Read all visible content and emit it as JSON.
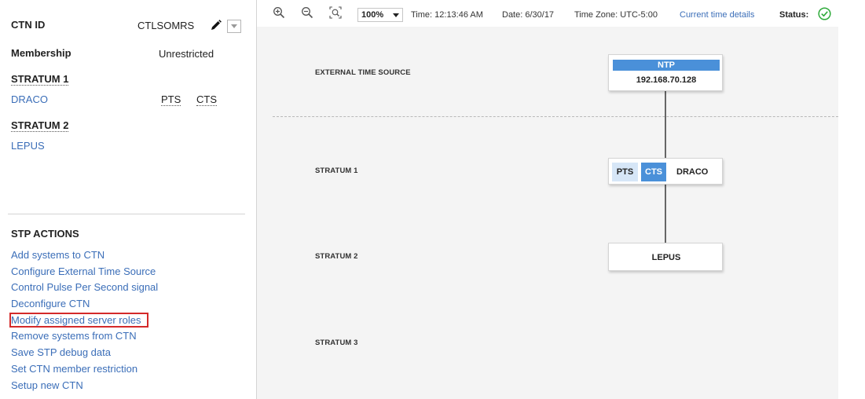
{
  "left_panel": {
    "ctn_id_label": "CTN ID",
    "ctn_id_value": "CTLSOMRS",
    "membership_label": "Membership",
    "membership_value": "Unrestricted",
    "stratum1_heading": "STRATUM 1",
    "stratum1_system": "DRACO",
    "roles": [
      "PTS",
      "CTS"
    ],
    "stratum2_heading": "STRATUM 2",
    "stratum2_system": "LEPUS",
    "actions_title": "STP ACTIONS",
    "actions": [
      "Add systems to CTN",
      "Configure External Time Source",
      "Control Pulse Per Second signal",
      "Deconfigure CTN",
      "Modify assigned server roles",
      "Remove systems from CTN",
      "Save STP debug data",
      "Set CTN member restriction",
      "Setup new CTN"
    ],
    "highlighted_action": "Modify assigned server roles"
  },
  "toolbar": {
    "zoom_in_icon": "zoom-in-icon",
    "zoom_out_icon": "zoom-out-icon",
    "fit_icon": "fit-to-view-icon",
    "zoom_level": "100%",
    "time": "Time: 12:13:46 AM",
    "date": "Date: 6/30/17",
    "timezone": "Time Zone: UTC-5:00",
    "time_details_link": "Current time details",
    "status_label": "Status:",
    "status_icon": "check-circle-icon",
    "status_color": "#2eaa3a"
  },
  "topology": {
    "tiers": [
      "EXTERNAL TIME SOURCE",
      "STRATUM 1",
      "STRATUM 2",
      "STRATUM 3"
    ],
    "ntp_label": "NTP",
    "ntp_address": "192.168.70.128",
    "stratum1_node": {
      "pts": "PTS",
      "cts": "CTS",
      "name": "DRACO"
    },
    "stratum2_node": {
      "name": "LEPUS"
    },
    "accent_color": "#4a90d9"
  }
}
